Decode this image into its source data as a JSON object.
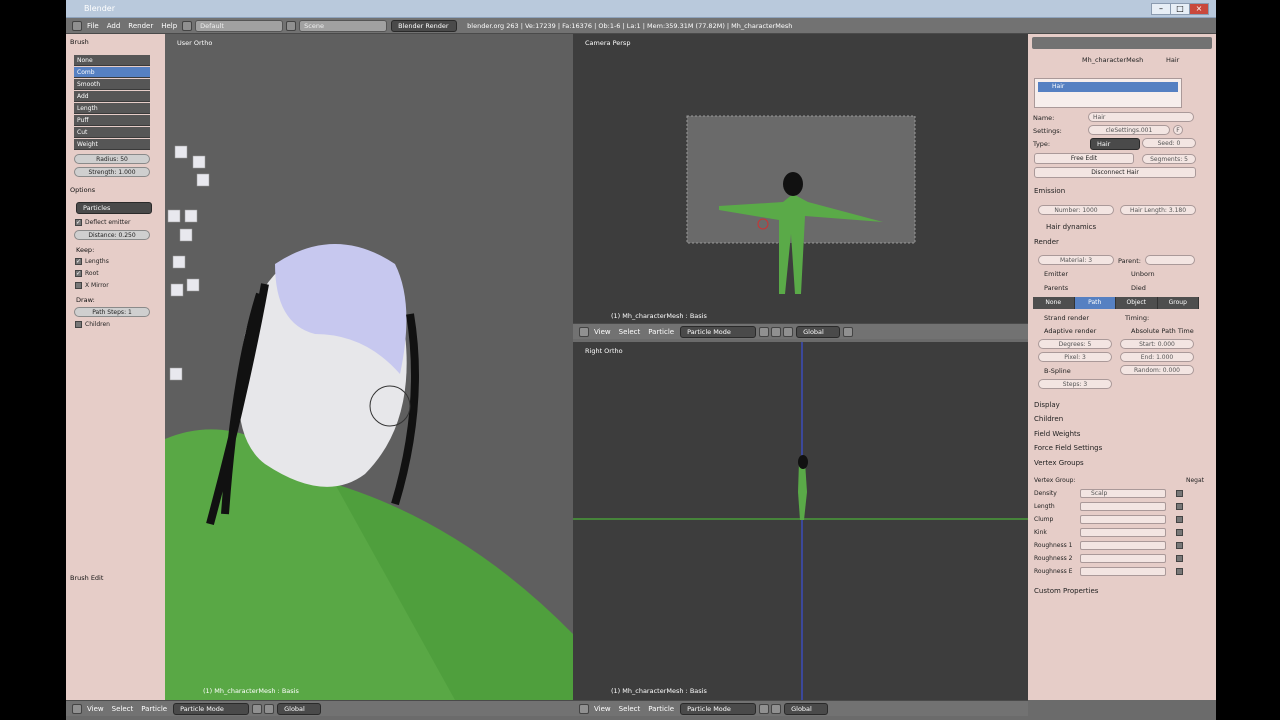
{
  "window": {
    "title": "Blender"
  },
  "header": {
    "menus": [
      "File",
      "Add",
      "Render",
      "Help"
    ],
    "layout": "Default",
    "scene": "Scene",
    "engine": "Blender Render",
    "info": "blender.org 263 | Ve:17239 | Fa:16376 | Ob:1-6 | La:1 | Mem:359.31M (77.82M) | Mh_characterMesh"
  },
  "toolshelf": {
    "brush_header": "Brush",
    "brushes": [
      "None",
      "Comb",
      "Smooth",
      "Add",
      "Length",
      "Puff",
      "Cut",
      "Weight"
    ],
    "radius": "Radius: 50",
    "strength": "Strength: 1.000",
    "options_header": "Options",
    "particles_select": "Particles",
    "deflect": "Deflect emitter",
    "distance": "Distance: 0.250",
    "keep": "Keep:",
    "lengths": "Lengths",
    "root": "Root",
    "xmirror": "X Mirror",
    "draw": "Draw:",
    "path_steps": "Path Steps: 1",
    "children": "Children",
    "brush_edit": "Brush Edit"
  },
  "viewports": {
    "left_label": "User Ortho",
    "cam_label": "Camera Persp",
    "right_label": "Right Ortho",
    "obj_label": "(1) Mh_characterMesh : Basis",
    "menus": [
      "View",
      "Select",
      "Particle"
    ],
    "mode": "Particle Mode",
    "orient": "Global"
  },
  "props": {
    "breadcrumb": "Mh_characterMesh",
    "breadcrumb2": "Hair",
    "list_item": "Hair",
    "name_label": "Name:",
    "name_value": "Hair",
    "settings_label": "Settings:",
    "settings_value": "cleSettings.001",
    "settings_f": "F",
    "type_label": "Type:",
    "type_value": "Hair",
    "seed": "Seed: 0",
    "free_edit": "Free Edit",
    "segments": "Segments: 5",
    "disconnect": "Disconnect Hair",
    "emission": "Emission",
    "number": "Number: 1000",
    "hair_length": "Hair Length: 3.180",
    "hair_dynamics": "Hair dynamics",
    "render": "Render",
    "material": "Material: 3",
    "parent": "Parent:",
    "emitter": "Emitter",
    "unborn": "Unborn",
    "parents": "Parents",
    "died": "Died",
    "tabs": [
      "None",
      "Path",
      "Object",
      "Group"
    ],
    "strand_render": "Strand render",
    "timing": "Timing:",
    "adaptive_render": "Adaptive render",
    "abs_path_time": "Absolute Path Time",
    "degrees": "Degrees: 5",
    "start": "Start: 0.000",
    "pixel": "Pixel: 3",
    "end": "End: 1.000",
    "bspline": "B-Spline",
    "random": "Random: 0.000",
    "steps": "Steps: 3",
    "display": "Display",
    "children": "Children",
    "field_weights": "Field Weights",
    "force_field": "Force Field Settings",
    "vertex_groups": "Vertex Groups",
    "vg_label": "Vertex Group:",
    "vg_negat": "Negat",
    "vg_rows": [
      "Density",
      "Length",
      "Clump",
      "Kink",
      "Roughness 1",
      "Roughness 2",
      "Roughness E"
    ],
    "vg_density_val": "Scalp",
    "custom_props": "Custom Properties"
  }
}
